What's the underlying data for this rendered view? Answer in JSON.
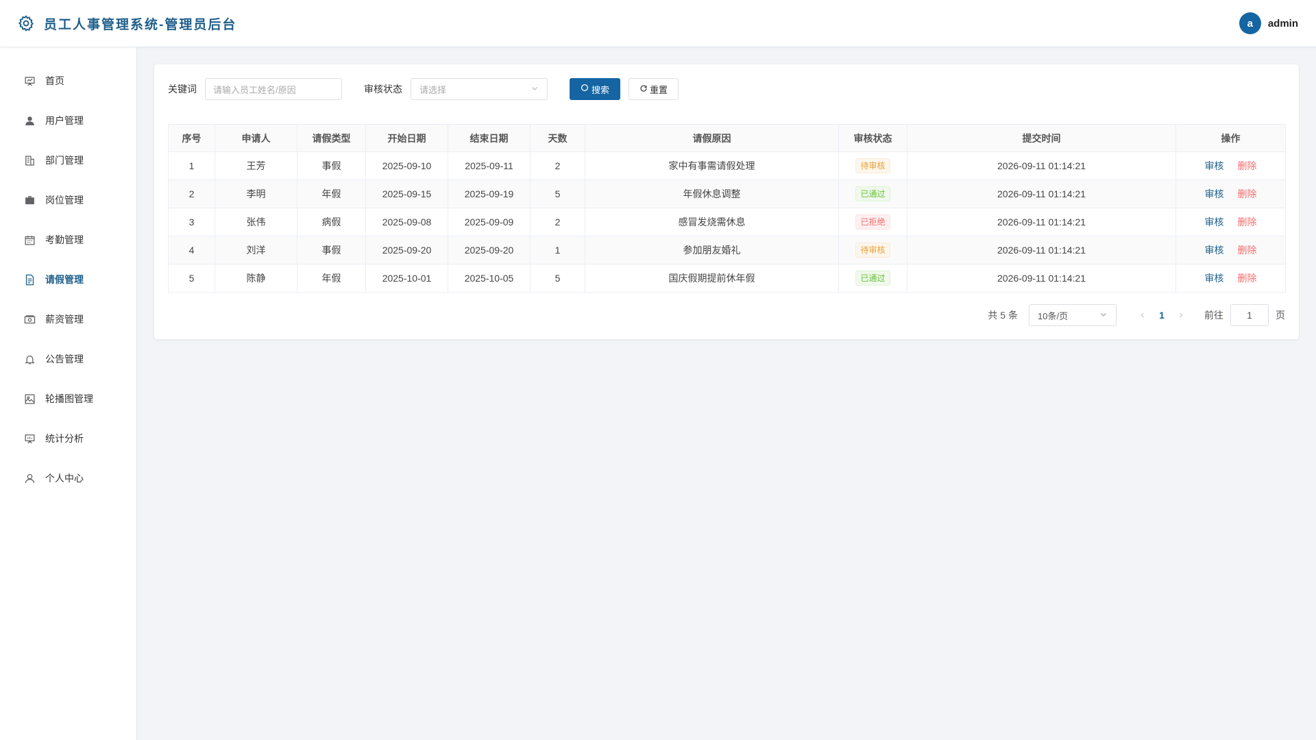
{
  "header": {
    "title": "员工人事管理系统-管理员后台",
    "avatar_letter": "a",
    "username": "admin"
  },
  "sidebar": {
    "items": [
      {
        "label": "首页",
        "icon": "presentation-icon"
      },
      {
        "label": "用户管理",
        "icon": "user-icon"
      },
      {
        "label": "部门管理",
        "icon": "office-building-icon"
      },
      {
        "label": "岗位管理",
        "icon": "briefcase-icon"
      },
      {
        "label": "考勤管理",
        "icon": "calendar-icon"
      },
      {
        "label": "请假管理",
        "icon": "document-icon"
      },
      {
        "label": "薪资管理",
        "icon": "money-icon"
      },
      {
        "label": "公告管理",
        "icon": "bell-icon"
      },
      {
        "label": "轮播图管理",
        "icon": "picture-icon"
      },
      {
        "label": "统计分析",
        "icon": "data-board-icon"
      },
      {
        "label": "个人中心",
        "icon": "user-outline-icon"
      }
    ],
    "active_index": 5
  },
  "filters": {
    "keyword_label": "关键词",
    "keyword_placeholder": "请输入员工姓名/原因",
    "status_label": "审核状态",
    "status_placeholder": "请选择",
    "search_button": "搜索",
    "reset_button": "重置"
  },
  "table": {
    "columns": [
      "序号",
      "申请人",
      "请假类型",
      "开始日期",
      "结束日期",
      "天数",
      "请假原因",
      "审核状态",
      "提交时间",
      "操作"
    ],
    "rows": [
      {
        "no": "1",
        "applicant": "王芳",
        "type": "事假",
        "start": "2025-09-10",
        "end": "2025-09-11",
        "days": "2",
        "reason": "家中有事需请假处理",
        "status": "待审核",
        "status_kind": "pending",
        "submitted": "2026-09-11 01:14:21"
      },
      {
        "no": "2",
        "applicant": "李明",
        "type": "年假",
        "start": "2025-09-15",
        "end": "2025-09-19",
        "days": "5",
        "reason": "年假休息调整",
        "status": "已通过",
        "status_kind": "approved",
        "submitted": "2026-09-11 01:14:21"
      },
      {
        "no": "3",
        "applicant": "张伟",
        "type": "病假",
        "start": "2025-09-08",
        "end": "2025-09-09",
        "days": "2",
        "reason": "感冒发烧需休息",
        "status": "已拒绝",
        "status_kind": "rejected",
        "submitted": "2026-09-11 01:14:21"
      },
      {
        "no": "4",
        "applicant": "刘洋",
        "type": "事假",
        "start": "2025-09-20",
        "end": "2025-09-20",
        "days": "1",
        "reason": "参加朋友婚礼",
        "status": "待审核",
        "status_kind": "pending",
        "submitted": "2026-09-11 01:14:21"
      },
      {
        "no": "5",
        "applicant": "陈静",
        "type": "年假",
        "start": "2025-10-01",
        "end": "2025-10-05",
        "days": "5",
        "reason": "国庆假期提前休年假",
        "status": "已通过",
        "status_kind": "approved",
        "submitted": "2026-09-11 01:14:21"
      }
    ],
    "review_label": "审核",
    "delete_label": "删除"
  },
  "pagination": {
    "total": "共 5 条",
    "page_size": "10条/页",
    "current_page": "1",
    "goto_label": "前往",
    "goto_value": "1",
    "goto_unit": "页"
  },
  "colors": {
    "primary": "#1565a3",
    "brand_text": "#1f5f8b",
    "pending": "#e6a23c",
    "approved": "#67c23a",
    "rejected": "#f56c6c"
  }
}
